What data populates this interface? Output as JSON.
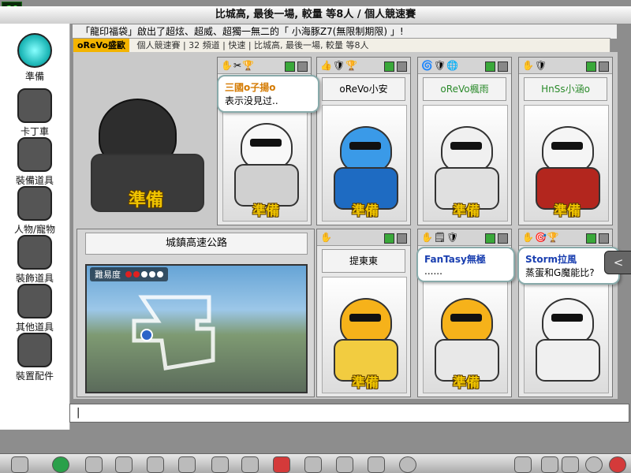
{
  "fps": "60",
  "title": "比城高, 最後一場, 較量 等8人 / 個人競速賽",
  "ticker": "「龍印福袋」啟出了超炫、超威、超獨一無二的「 小海豚Z7(無限制期限) 」!",
  "room_bar": {
    "host_name": "oReVo盛歐",
    "info": "個人競速賽  |  32 頻道  |  快速  |  比城高, 最後一場, 較量 等8人"
  },
  "left_menu": [
    {
      "label": "準備"
    },
    {
      "label": "卡丁車"
    },
    {
      "label": "裝備道具"
    },
    {
      "label": "人物/寵物"
    },
    {
      "label": "裝飾道具"
    },
    {
      "label": "其他道具"
    },
    {
      "label": "裝置配件"
    }
  ],
  "host": {
    "ready_label": "準備"
  },
  "players": [
    {
      "name": "",
      "ready": "準備",
      "bubble_name": "三國o子揚o",
      "bubble_text": "表示没見过..",
      "colors": {
        "char": "#f8f8f8",
        "kart": "#d0d0d0"
      }
    },
    {
      "name": "oReVo小安",
      "ready": "準備",
      "colors": {
        "char": "#3a9ae8",
        "kart": "#1e6bc2"
      }
    },
    {
      "name": "oReVo楓雨",
      "ready": "準備",
      "colors": {
        "char": "#f0f0f0",
        "kart": "#e0e0e0"
      }
    },
    {
      "name": "HnSs小涵o",
      "ready": "準備",
      "colors": {
        "char": "#f5f5f5",
        "kart": "#b3261e"
      }
    },
    {
      "name": "提東東",
      "ready": "準備",
      "colors": {
        "char": "#f6b21a",
        "kart": "#f2cc40"
      }
    },
    {
      "name": "",
      "ready": "準備",
      "bubble_name": "FanTasy無極",
      "bubble_text": "......",
      "colors": {
        "char": "#f6b21a",
        "kart": "#e8e8e8"
      }
    },
    {
      "name": "",
      "ready": "",
      "bubble_name": "Storm拉風",
      "bubble_text": "蒸蛋和G魔能比?",
      "colors": {
        "char": "#f5f5f5",
        "kart": "#f0f0f0"
      }
    }
  ],
  "track": {
    "name": "城鎮高速公路",
    "difficulty_label": "難易度",
    "difficulty": 2,
    "difficulty_max": 5
  },
  "chat": {
    "value": "|"
  },
  "side_button": "<"
}
